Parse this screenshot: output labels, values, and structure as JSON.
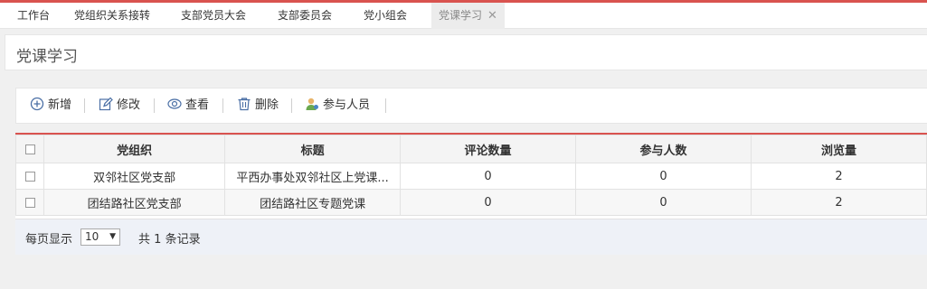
{
  "tabs": [
    {
      "label": "工作台"
    },
    {
      "label": "党组织关系接转"
    },
    {
      "label": "支部党员大会"
    },
    {
      "label": "支部委员会"
    },
    {
      "label": "党小组会"
    },
    {
      "label": "党课学习",
      "active": true
    }
  ],
  "page": {
    "title": "党课学习"
  },
  "toolbar": {
    "add_label": "新增",
    "edit_label": "修改",
    "view_label": "查看",
    "delete_label": "删除",
    "participants_label": "参与人员"
  },
  "table": {
    "columns": [
      "党组织",
      "标题",
      "评论数量",
      "参与人数",
      "浏览量"
    ],
    "rows": [
      [
        "双邻社区党支部",
        "平西办事处双邻社区上党课...",
        "0",
        "0",
        "2"
      ],
      [
        "团结路社区党支部",
        "团结路社区专题党课",
        "0",
        "0",
        "2"
      ]
    ]
  },
  "pager": {
    "label": "每页显示",
    "page_size": "10",
    "total_prefix": "共",
    "total_count": "1",
    "total_suffix": "条记录"
  },
  "colors": {
    "accent": "#d9534f",
    "pager_bg": "#eef1f7"
  },
  "icons": [
    "close-icon",
    "plus-circle-icon",
    "edit-icon",
    "eye-icon",
    "trash-icon",
    "user-icon"
  ]
}
